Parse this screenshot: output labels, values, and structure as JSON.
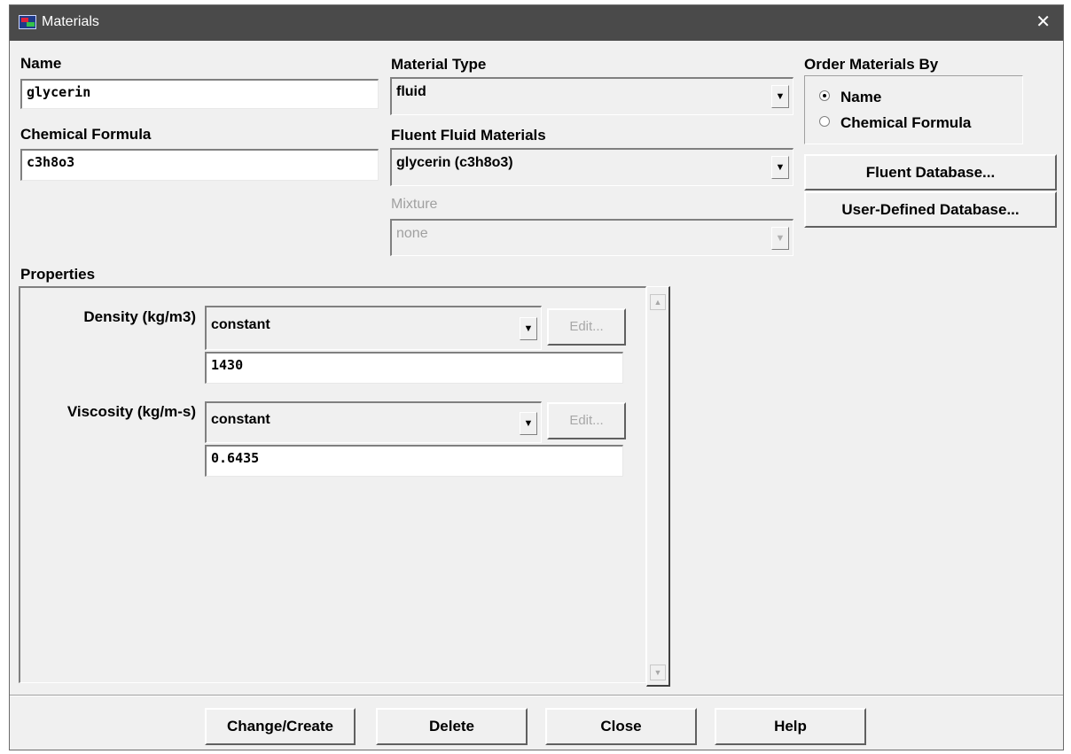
{
  "window": {
    "title": "Materials",
    "close_label": "✕"
  },
  "name": {
    "label": "Name",
    "value": "glycerin"
  },
  "chemical_formula": {
    "label": "Chemical Formula",
    "value": "c3h8o3"
  },
  "material_type": {
    "label": "Material Type",
    "value": "fluid"
  },
  "fluent_fluid_materials": {
    "label": "Fluent Fluid Materials",
    "value": "glycerin (c3h8o3)"
  },
  "mixture": {
    "label": "Mixture",
    "value": "none"
  },
  "order_by": {
    "label": "Order Materials By",
    "options": [
      {
        "label": "Name",
        "selected": true
      },
      {
        "label": "Chemical Formula",
        "selected": false
      }
    ]
  },
  "database_buttons": {
    "fluent": "Fluent Database...",
    "user_defined": "User-Defined Database..."
  },
  "properties": {
    "label": "Properties",
    "density": {
      "label": "Density (kg/m3)",
      "method": "constant",
      "edit_label": "Edit...",
      "value": "1430"
    },
    "viscosity": {
      "label": "Viscosity (kg/m-s)",
      "method": "constant",
      "edit_label": "Edit...",
      "value": "0.6435"
    }
  },
  "footer": {
    "change_create": "Change/Create",
    "delete": "Delete",
    "close": "Close",
    "help": "Help"
  },
  "icons": {
    "dropdown": "▼",
    "scroll_up": "▲",
    "scroll_down": "▼"
  }
}
